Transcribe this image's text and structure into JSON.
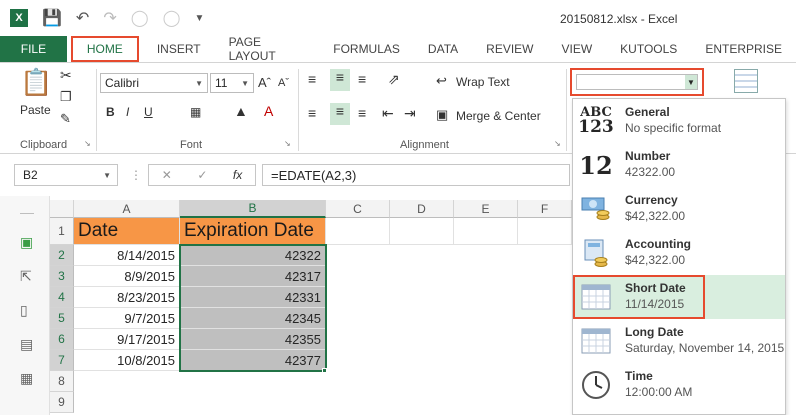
{
  "window": {
    "title": "20150812.xlsx - Excel"
  },
  "tabs": [
    "FILE",
    "HOME",
    "INSERT",
    "PAGE LAYOUT",
    "FORMULAS",
    "DATA",
    "REVIEW",
    "VIEW",
    "KUTOOLS",
    "ENTERPRISE"
  ],
  "ribbon": {
    "paste_label": "Paste",
    "font_name": "Calibri",
    "font_size": "11",
    "wrap_text": "Wrap Text",
    "merge_center": "Merge & Center",
    "group_clipboard": "Clipboard",
    "group_font": "Font",
    "group_alignment": "Alignment",
    "number_format_value": ""
  },
  "formula_bar": {
    "name_box": "B2",
    "formula": "=EDATE(A2,3)",
    "fx": "fx"
  },
  "sheet": {
    "columns": [
      "A",
      "B",
      "C",
      "D",
      "E",
      "F"
    ],
    "rows": [
      "1",
      "2",
      "3",
      "4",
      "5",
      "6",
      "7",
      "8",
      "9"
    ],
    "header": {
      "a": "Date",
      "b": "Expiration Date"
    },
    "data": [
      {
        "a": "8/14/2015",
        "b": "42322"
      },
      {
        "a": "8/9/2015",
        "b": "42317"
      },
      {
        "a": "8/23/2015",
        "b": "42331"
      },
      {
        "a": "9/7/2015",
        "b": "42345"
      },
      {
        "a": "9/17/2015",
        "b": "42355"
      },
      {
        "a": "10/8/2015",
        "b": "42377"
      }
    ]
  },
  "number_format_menu": [
    {
      "title": "General",
      "subtitle": "No specific format",
      "icon": "abc-123-icon"
    },
    {
      "title": "Number",
      "subtitle": "42322.00",
      "icon": "number-12-icon"
    },
    {
      "title": "Currency",
      "subtitle": "$42,322.00",
      "icon": "currency-icon"
    },
    {
      "title": "Accounting",
      "subtitle": " $42,322.00",
      "icon": "accounting-icon"
    },
    {
      "title": "Short Date",
      "subtitle": "11/14/2015",
      "icon": "calendar-icon"
    },
    {
      "title": "Long Date",
      "subtitle": "Saturday, November 14, 2015",
      "icon": "calendar-icon"
    },
    {
      "title": "Time",
      "subtitle": "12:00:00 AM",
      "icon": "clock-icon"
    }
  ],
  "icons": {
    "general_top": "ABC",
    "general_bottom": "123",
    "number": "12"
  },
  "colors": {
    "accent": "#217346",
    "highlight": "#e64a2e",
    "header_fill": "#f79646",
    "menu_selected": "#d9eedf"
  }
}
